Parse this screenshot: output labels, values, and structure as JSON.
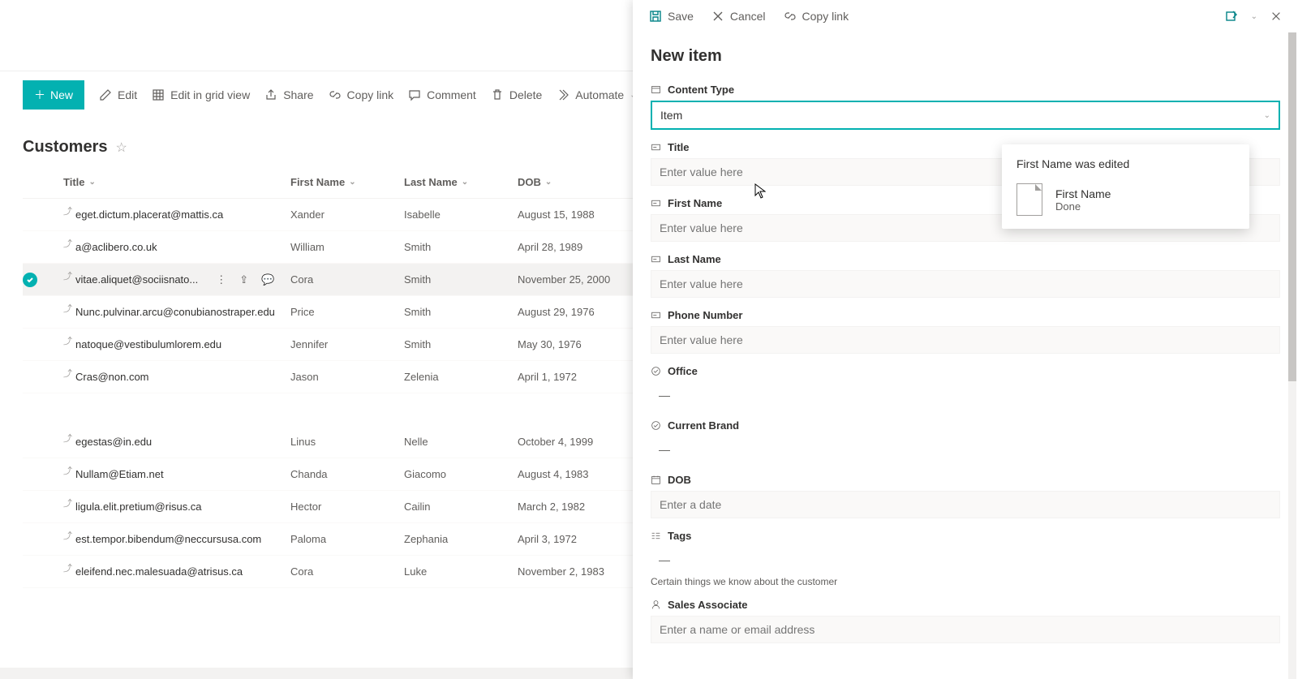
{
  "cmdbar": {
    "new": "New",
    "edit": "Edit",
    "gridview": "Edit in grid view",
    "share": "Share",
    "copylink": "Copy link",
    "comment": "Comment",
    "delete": "Delete",
    "automate": "Automate"
  },
  "list": {
    "title": "Customers",
    "columns": {
      "title": "Title",
      "first": "First Name",
      "last": "Last Name",
      "dob": "DOB"
    },
    "rows": [
      {
        "email": "eget.dictum.placerat@mattis.ca",
        "first": "Xander",
        "last": "Isabelle",
        "dob": "August 15, 1988",
        "selected": false
      },
      {
        "email": "a@aclibero.co.uk",
        "first": "William",
        "last": "Smith",
        "dob": "April 28, 1989",
        "selected": false
      },
      {
        "email": "vitae.aliquet@sociisnato...",
        "first": "Cora",
        "last": "Smith",
        "dob": "November 25, 2000",
        "selected": true
      },
      {
        "email": "Nunc.pulvinar.arcu@conubianostraper.edu",
        "first": "Price",
        "last": "Smith",
        "dob": "August 29, 1976",
        "selected": false
      },
      {
        "email": "natoque@vestibulumlorem.edu",
        "first": "Jennifer",
        "last": "Smith",
        "dob": "May 30, 1976",
        "selected": false
      },
      {
        "email": "Cras@non.com",
        "first": "Jason",
        "last": "Zelenia",
        "dob": "April 1, 1972",
        "selected": false
      },
      {
        "gap": true
      },
      {
        "email": "egestas@in.edu",
        "first": "Linus",
        "last": "Nelle",
        "dob": "October 4, 1999",
        "selected": false
      },
      {
        "email": "Nullam@Etiam.net",
        "first": "Chanda",
        "last": "Giacomo",
        "dob": "August 4, 1983",
        "selected": false
      },
      {
        "email": "ligula.elit.pretium@risus.ca",
        "first": "Hector",
        "last": "Cailin",
        "dob": "March 2, 1982",
        "selected": false
      },
      {
        "email": "est.tempor.bibendum@neccursusa.com",
        "first": "Paloma",
        "last": "Zephania",
        "dob": "April 3, 1972",
        "selected": false
      },
      {
        "email": "eleifend.nec.malesuada@atrisus.ca",
        "first": "Cora",
        "last": "Luke",
        "dob": "November 2, 1983",
        "selected": false
      }
    ]
  },
  "panel": {
    "actions": {
      "save": "Save",
      "cancel": "Cancel",
      "copylink": "Copy link"
    },
    "heading": "New item",
    "fields": {
      "content_type": {
        "label": "Content Type",
        "value": "Item"
      },
      "title": {
        "label": "Title",
        "placeholder": "Enter value here"
      },
      "first_name": {
        "label": "First Name",
        "placeholder": "Enter value here"
      },
      "last_name": {
        "label": "Last Name",
        "placeholder": "Enter value here"
      },
      "phone": {
        "label": "Phone Number",
        "placeholder": "Enter value here"
      },
      "office": {
        "label": "Office",
        "empty": "—"
      },
      "brand": {
        "label": "Current Brand",
        "empty": "—"
      },
      "dob": {
        "label": "DOB",
        "placeholder": "Enter a date"
      },
      "tags": {
        "label": "Tags",
        "empty": "—",
        "helper": "Certain things we know about the customer"
      },
      "sales": {
        "label": "Sales Associate",
        "placeholder": "Enter a name or email address"
      }
    }
  },
  "notify": {
    "title": "First Name was edited",
    "line1": "First Name",
    "line2": "Done"
  }
}
